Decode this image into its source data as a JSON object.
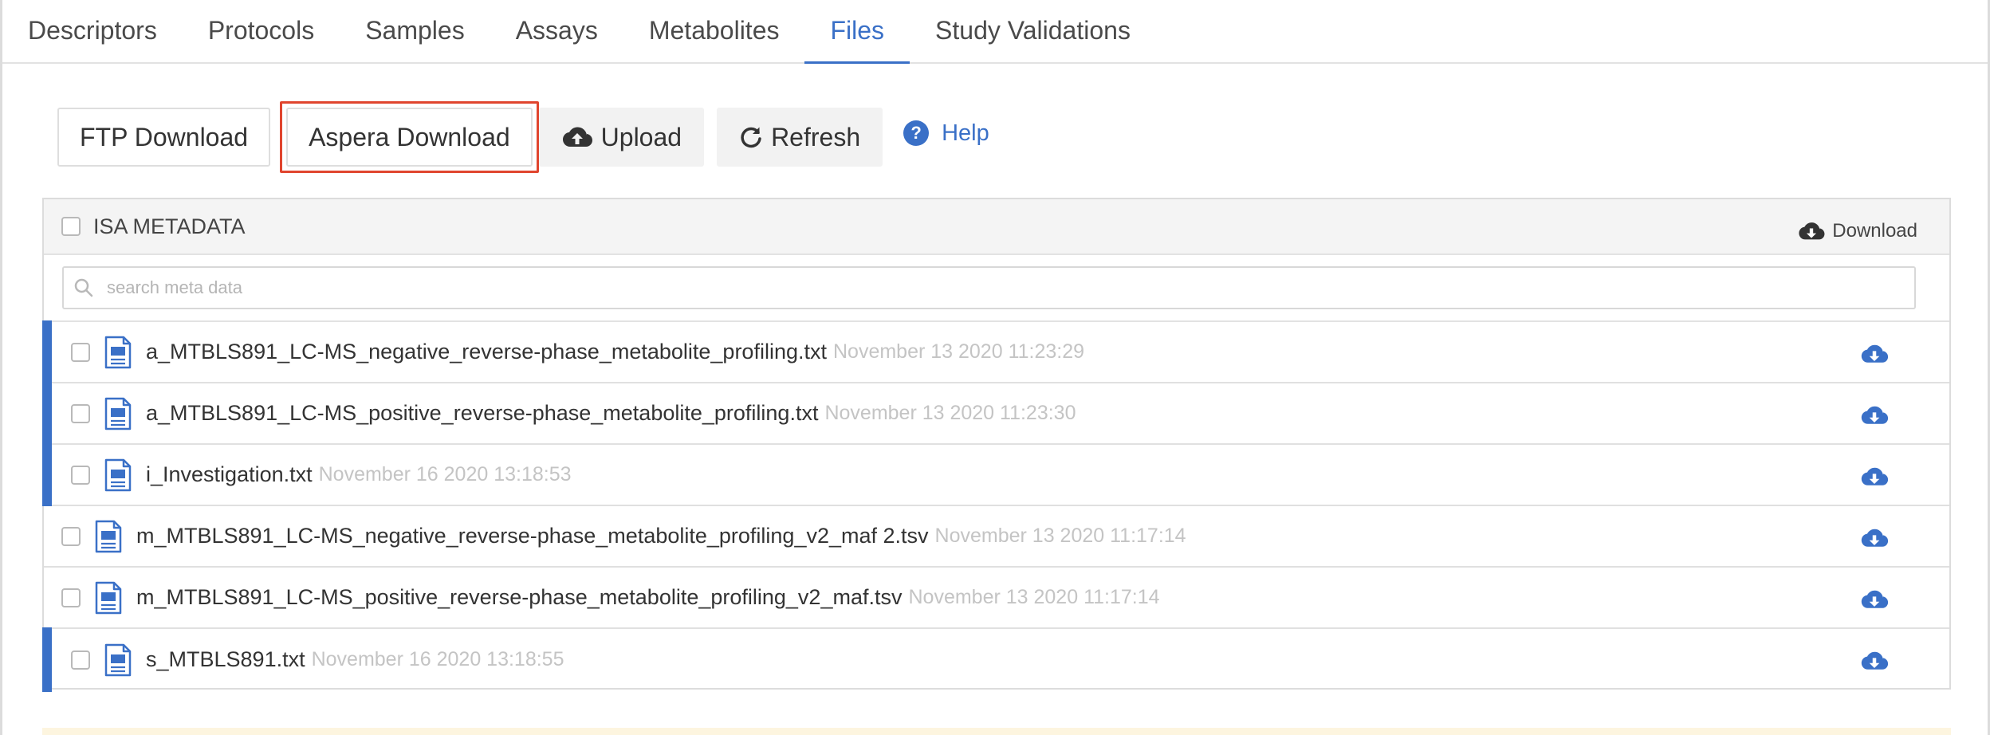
{
  "tabs": [
    {
      "label": "Descriptors",
      "active": false
    },
    {
      "label": "Protocols",
      "active": false
    },
    {
      "label": "Samples",
      "active": false
    },
    {
      "label": "Assays",
      "active": false
    },
    {
      "label": "Metabolites",
      "active": false
    },
    {
      "label": "Files",
      "active": true
    },
    {
      "label": "Study Validations",
      "active": false
    }
  ],
  "toolbar": {
    "ftp_label": "FTP Download",
    "aspera_label": "Aspera Download",
    "upload_label": "Upload",
    "refresh_label": "Refresh",
    "help_label": "Help",
    "upload_icon": "cloud-upload-icon",
    "refresh_icon": "refresh-icon",
    "help_icon": "help-icon"
  },
  "panel": {
    "header_label": "ISA METADATA",
    "download_label": "Download",
    "search_placeholder": "search meta data"
  },
  "files": [
    {
      "name": "a_MTBLS891_LC-MS_negative_reverse-phase_metabolite_profiling.txt",
      "date": "November 13 2020 11:23:29",
      "flagged": true
    },
    {
      "name": "a_MTBLS891_LC-MS_positive_reverse-phase_metabolite_profiling.txt",
      "date": "November 13 2020 11:23:30",
      "flagged": true
    },
    {
      "name": "i_Investigation.txt",
      "date": "November 16 2020 13:18:53",
      "flagged": true
    },
    {
      "name": "m_MTBLS891_LC-MS_negative_reverse-phase_metabolite_profiling_v2_maf 2.tsv",
      "date": "November 13 2020 11:17:14",
      "flagged": false
    },
    {
      "name": "m_MTBLS891_LC-MS_positive_reverse-phase_metabolite_profiling_v2_maf.tsv",
      "date": "November 13 2020 11:17:14",
      "flagged": false
    },
    {
      "name": "s_MTBLS891.txt",
      "date": "November 16 2020 13:18:55",
      "flagged": true
    }
  ],
  "colors": {
    "accent": "#3a70c7",
    "highlight_border": "#e0452e",
    "date_text": "#c4c4c4"
  }
}
